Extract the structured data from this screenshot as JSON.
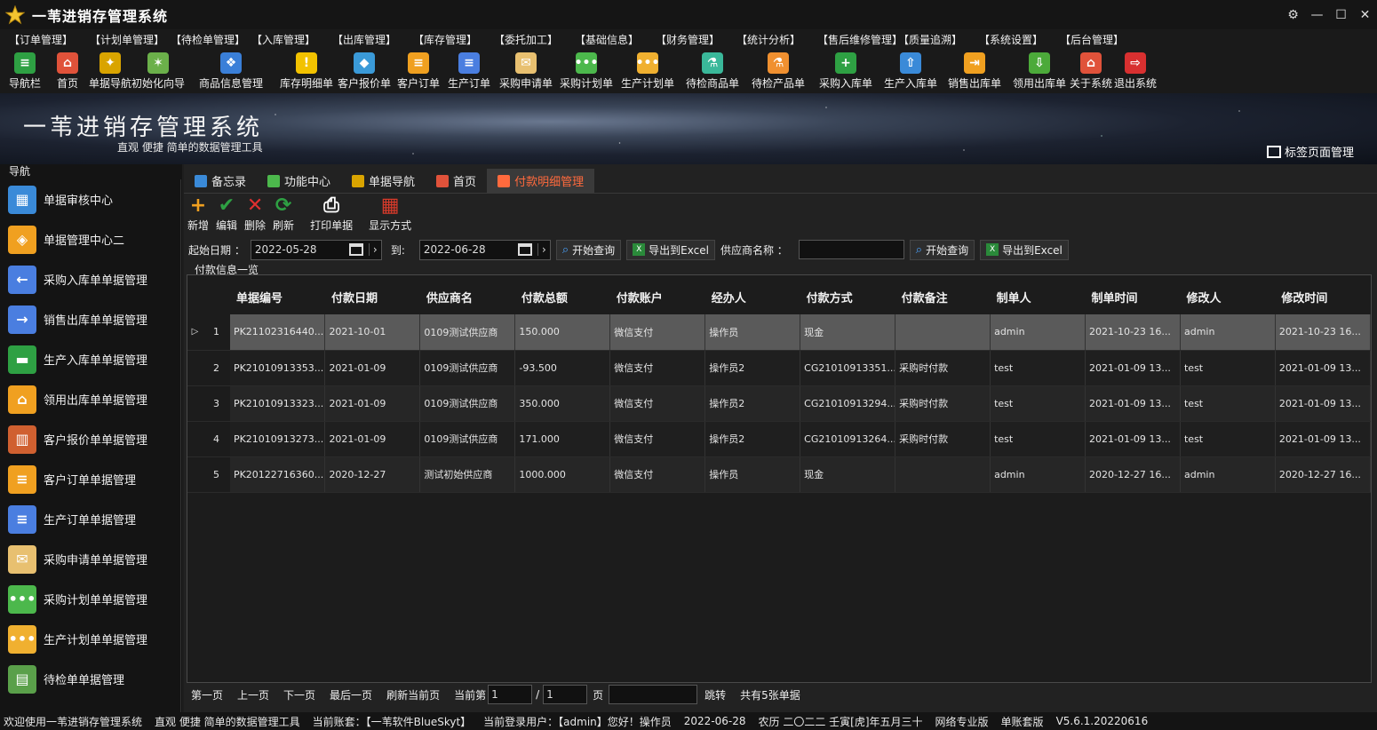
{
  "window": {
    "title": "一苇进销存管理系统",
    "controls": [
      "⚙",
      "—",
      "☐",
      "✕"
    ]
  },
  "menu": [
    "【订单管理】",
    "【计划单管理】",
    "【待检单管理】",
    "【入库管理】",
    "【出库管理】",
    "【库存管理】",
    "【委托加工】",
    "【基础信息】",
    "【财务管理】",
    "【统计分析】",
    "【售后维修管理】",
    "【质量追溯】",
    "【系统设置】",
    "【后台管理】"
  ],
  "toolbar": [
    {
      "label": "导航栏",
      "icon": "menu-icon",
      "color": "#2ea043",
      "glyph": "≡"
    },
    {
      "label": "首页",
      "icon": "home-icon",
      "color": "#e0523a",
      "glyph": "⌂"
    },
    {
      "label": "单据导航",
      "icon": "magic-icon",
      "color": "#d9a400",
      "glyph": "✦"
    },
    {
      "label": "初始化向导",
      "icon": "wand-icon",
      "color": "#6bb04a",
      "glyph": "✶"
    },
    {
      "label": "商品信息管理",
      "icon": "cubes-icon",
      "color": "#3a7fd8",
      "glyph": "❖"
    },
    {
      "label": "库存明细单",
      "icon": "warning-icon",
      "color": "#f2c200",
      "glyph": "!"
    },
    {
      "label": "客户报价单",
      "icon": "tag-icon",
      "color": "#3a9ad8",
      "glyph": "◆"
    },
    {
      "label": "客户订单",
      "icon": "doc-orange-icon",
      "color": "#f0a020",
      "glyph": "≡"
    },
    {
      "label": "生产订单",
      "icon": "doc-blue-icon",
      "color": "#4a7ee0",
      "glyph": "≡"
    },
    {
      "label": "采购申请单",
      "icon": "mail-icon",
      "color": "#e8c070",
      "glyph": "✉"
    },
    {
      "label": "采购计划单",
      "icon": "chat-green-icon",
      "color": "#4cb84c",
      "glyph": "•••"
    },
    {
      "label": "生产计划单",
      "icon": "chat-yellow-icon",
      "color": "#f0b030",
      "glyph": "•••"
    },
    {
      "label": "待检商品单",
      "icon": "flask-icon",
      "color": "#3ab89a",
      "glyph": "⚗"
    },
    {
      "label": "待检产品单",
      "icon": "flask-orange-icon",
      "color": "#f09030",
      "glyph": "⚗"
    },
    {
      "label": "采购入库单",
      "icon": "plus-icon",
      "color": "#2ea043",
      "glyph": "+"
    },
    {
      "label": "生产入库单",
      "icon": "hand-truck-icon",
      "color": "#3a8ad8",
      "glyph": "⇧"
    },
    {
      "label": "销售出库单",
      "icon": "export-icon",
      "color": "#f0a020",
      "glyph": "⇥"
    },
    {
      "label": "领用出库单",
      "icon": "download-icon",
      "color": "#4caa3a",
      "glyph": "⇩"
    },
    {
      "label": "关于系统",
      "icon": "house-icon",
      "color": "#e0523a",
      "glyph": "⌂"
    },
    {
      "label": "退出系统",
      "icon": "exit-icon",
      "color": "#d83030",
      "glyph": "⇨"
    }
  ],
  "banner": {
    "title": "一苇进销存管理系统",
    "subtitle": "直观 便捷 简单的数据管理工具",
    "tag_manager": "标签页面管理"
  },
  "sidebar": {
    "heading": "导航",
    "items": [
      {
        "label": "单据审核中心",
        "icon": "grid-icon",
        "color": "#3a8ad8",
        "glyph": "▦"
      },
      {
        "label": "单据管理中心二",
        "icon": "grid-orange-icon",
        "color": "#f0a020",
        "glyph": "◈"
      },
      {
        "label": "采购入库单单据管理",
        "icon": "arrow-left-icon",
        "color": "#4a7ee0",
        "glyph": "←"
      },
      {
        "label": "销售出库单单据管理",
        "icon": "arrow-right-icon",
        "color": "#4a7ee0",
        "glyph": "→"
      },
      {
        "label": "生产入库单单据管理",
        "icon": "folder-green-icon",
        "color": "#2ea043",
        "glyph": "▬"
      },
      {
        "label": "领用出库单单据管理",
        "icon": "house-orange-icon",
        "color": "#f0a020",
        "glyph": "⌂"
      },
      {
        "label": "客户报价单单据管理",
        "icon": "books-icon",
        "color": "#d06030",
        "glyph": "▥"
      },
      {
        "label": "客户订单单据管理",
        "icon": "doc-orange-icon",
        "color": "#f0a020",
        "glyph": "≡"
      },
      {
        "label": "生产订单单据管理",
        "icon": "doc-blue-icon",
        "color": "#4a7ee0",
        "glyph": "≡"
      },
      {
        "label": "采购申请单单据管理",
        "icon": "mail-icon",
        "color": "#e8c070",
        "glyph": "✉"
      },
      {
        "label": "采购计划单单据管理",
        "icon": "chat-green-icon",
        "color": "#4cb84c",
        "glyph": "•••"
      },
      {
        "label": "生产计划单单据管理",
        "icon": "chat-yellow-icon",
        "color": "#f0b030",
        "glyph": "•••"
      },
      {
        "label": "待检单单据管理",
        "icon": "clipboard-icon",
        "color": "#5aa04a",
        "glyph": "▤"
      }
    ]
  },
  "tabs": [
    {
      "label": "备忘录",
      "icon": "memo-icon",
      "color": "#3a8ad8",
      "active": false
    },
    {
      "label": "功能中心",
      "icon": "function-icon",
      "color": "#4cb84c",
      "active": false
    },
    {
      "label": "单据导航",
      "icon": "magic-icon",
      "color": "#d9a400",
      "active": false
    },
    {
      "label": "首页",
      "icon": "home-icon",
      "color": "#e0523a",
      "active": false
    },
    {
      "label": "付款明细管理",
      "icon": "payment-icon",
      "color": "#ff6a3d",
      "active": true
    }
  ],
  "actions": [
    {
      "label": "新增",
      "icon": "add-icon",
      "glyph": "+",
      "color": "#f0a020"
    },
    {
      "label": "编辑",
      "icon": "check-icon",
      "glyph": "✔",
      "color": "#2ea043"
    },
    {
      "label": "删除",
      "icon": "delete-icon",
      "glyph": "✕",
      "color": "#e03030"
    },
    {
      "label": "刷新",
      "icon": "refresh-icon",
      "glyph": "⟳",
      "color": "#2ea043"
    },
    {
      "label": "打印单据",
      "icon": "printer-icon",
      "glyph": "⎙",
      "color": "#ffffff"
    },
    {
      "label": "显示方式",
      "icon": "layout-icon",
      "glyph": "▦",
      "color": "#d83a2a"
    }
  ],
  "filter": {
    "start_label": "起始日期 ：",
    "start_date": "2022-05-28",
    "to_label": "到:",
    "end_date": "2022-06-28",
    "query_label": "开始查询",
    "export_label": "导出到Excel",
    "supplier_label": "供应商名称 ：",
    "supplier_value": "",
    "query2_label": "开始查询",
    "export2_label": "导出到Excel"
  },
  "group_label": "付款信息一览",
  "table": {
    "columns": [
      "单据编号",
      "付款日期",
      "供应商名",
      "付款总额",
      "付款账户",
      "经办人",
      "付款方式",
      "付款备注",
      "制单人",
      "制单时间",
      "修改人",
      "修改时间"
    ],
    "rows": [
      [
        "PK21102316440...",
        "2021-10-01",
        "0109测试供应商",
        "150.000",
        "微信支付",
        "操作员",
        "现金",
        "",
        "admin",
        "2021-10-23 16...",
        "admin",
        "2021-10-23 16..."
      ],
      [
        "PK21010913353...",
        "2021-01-09",
        "0109测试供应商",
        "-93.500",
        "微信支付",
        "操作员2",
        "CG21010913351...",
        "采购时付款",
        "test",
        "2021-01-09 13...",
        "test",
        "2021-01-09 13..."
      ],
      [
        "PK21010913323...",
        "2021-01-09",
        "0109测试供应商",
        "350.000",
        "微信支付",
        "操作员2",
        "CG21010913294...",
        "采购时付款",
        "test",
        "2021-01-09 13...",
        "test",
        "2021-01-09 13..."
      ],
      [
        "PK21010913273...",
        "2021-01-09",
        "0109测试供应商",
        "171.000",
        "微信支付",
        "操作员2",
        "CG21010913264...",
        "采购时付款",
        "test",
        "2021-01-09 13...",
        "test",
        "2021-01-09 13..."
      ],
      [
        "PK20122716360...",
        "2020-12-27",
        "测试初始供应商",
        "1000.000",
        "微信支付",
        "操作员",
        "现金",
        "",
        "admin",
        "2020-12-27 16...",
        "admin",
        "2020-12-27 16..."
      ]
    ],
    "row_numbers": [
      "1",
      "2",
      "3",
      "4",
      "5"
    ],
    "selected_marker": "▷"
  },
  "pager": {
    "first": "第一页",
    "prev": "上一页",
    "next": "下一页",
    "last": "最后一页",
    "refresh": "刷新当前页",
    "current_label": "当前第",
    "current_page": "1",
    "slash": "/",
    "total_pages": "1",
    "page_unit": "页",
    "jump_value": "",
    "jump": "跳转",
    "total": "共有5张单据"
  },
  "status": [
    "欢迎使用一苇进销存管理系统",
    "直观 便捷 简单的数据管理工具",
    "当前账套：【一苇软件BlueSkyt】",
    "当前登录用户：【admin】您好！操作员",
    "2022-06-28",
    "农历 二〇二二 壬寅[虎]年五月三十",
    "网络专业版",
    "单账套版",
    "V5.6.1.20220616"
  ]
}
